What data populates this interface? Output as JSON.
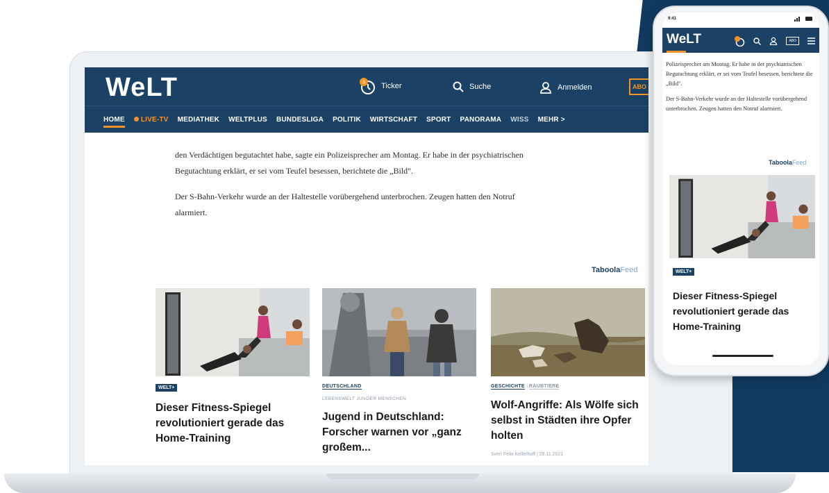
{
  "desktop": {
    "logo": "WeLT",
    "header": {
      "ticker": "Ticker",
      "search": "Suche",
      "login": "Anmelden",
      "abo": "ABO"
    },
    "nav": [
      "HOME",
      "LIVE-TV",
      "MEDIATHEK",
      "WELTPLUS",
      "BUNDESLIGA",
      "POLITIK",
      "WIRTSCHAFT",
      "SPORT",
      "PANORAMA",
      "WISS",
      "MEHR >"
    ],
    "article": [
      "den Verdächtigen begutachtet habe, sagte ein Polizeisprecher am Montag. Er habe in der psychiatrischen Begutachtung erklärt, er sei vom Teufel besessen, berichtete die „Bild\".",
      "Der S-Bahn-Verkehr wurde an der Haltestelle vorübergehend unterbrochen. Zeugen hatten den Notruf alarmiert."
    ],
    "taboola": {
      "brand": "Taboola",
      "feed": "Feed"
    },
    "cards": [
      {
        "badge": "WELT+",
        "headline": "Dieser Fitness-Spiegel revolutioniert gerade das Home-Training"
      },
      {
        "tag": "DEUTSCHLAND",
        "subtag": "LEBENSWELT JUNGER MENSCHEN",
        "headline": "Jugend in Deutschland: Forscher warnen vor „ganz großem..."
      },
      {
        "tag": "GESCHICHTE",
        "tag2": "RAUBTIERE",
        "headline": "Wolf-Angriffe: Als Wölfe sich selbst in Städten ihre Opfer holten",
        "meta": "Sven Felix Kellerhoff | 29.11.2021"
      }
    ]
  },
  "phone": {
    "time": "9:41",
    "logo": "WeLT",
    "abo": "ABO",
    "text": [
      "Polizeisprecher am Montag. Er habe in der psychiatrischen Begutachtung erklärt, er sei vom Teufel besessen, berichtete die „Bild\".",
      "Der S-Bahn-Verkehr wurde an der Haltestelle vorübergehend unterbrochen. Zeugen hatten den Notruf alarmiert."
    ],
    "taboola": {
      "brand": "Taboola",
      "feed": "Feed"
    },
    "badge": "WELT+",
    "headline": "Dieser Fitness-Spiegel revolutioniert gerade das Home-Training"
  },
  "colors": {
    "navy": "#1b4264",
    "accent": "#f39325",
    "backdrop": "#123a61"
  }
}
